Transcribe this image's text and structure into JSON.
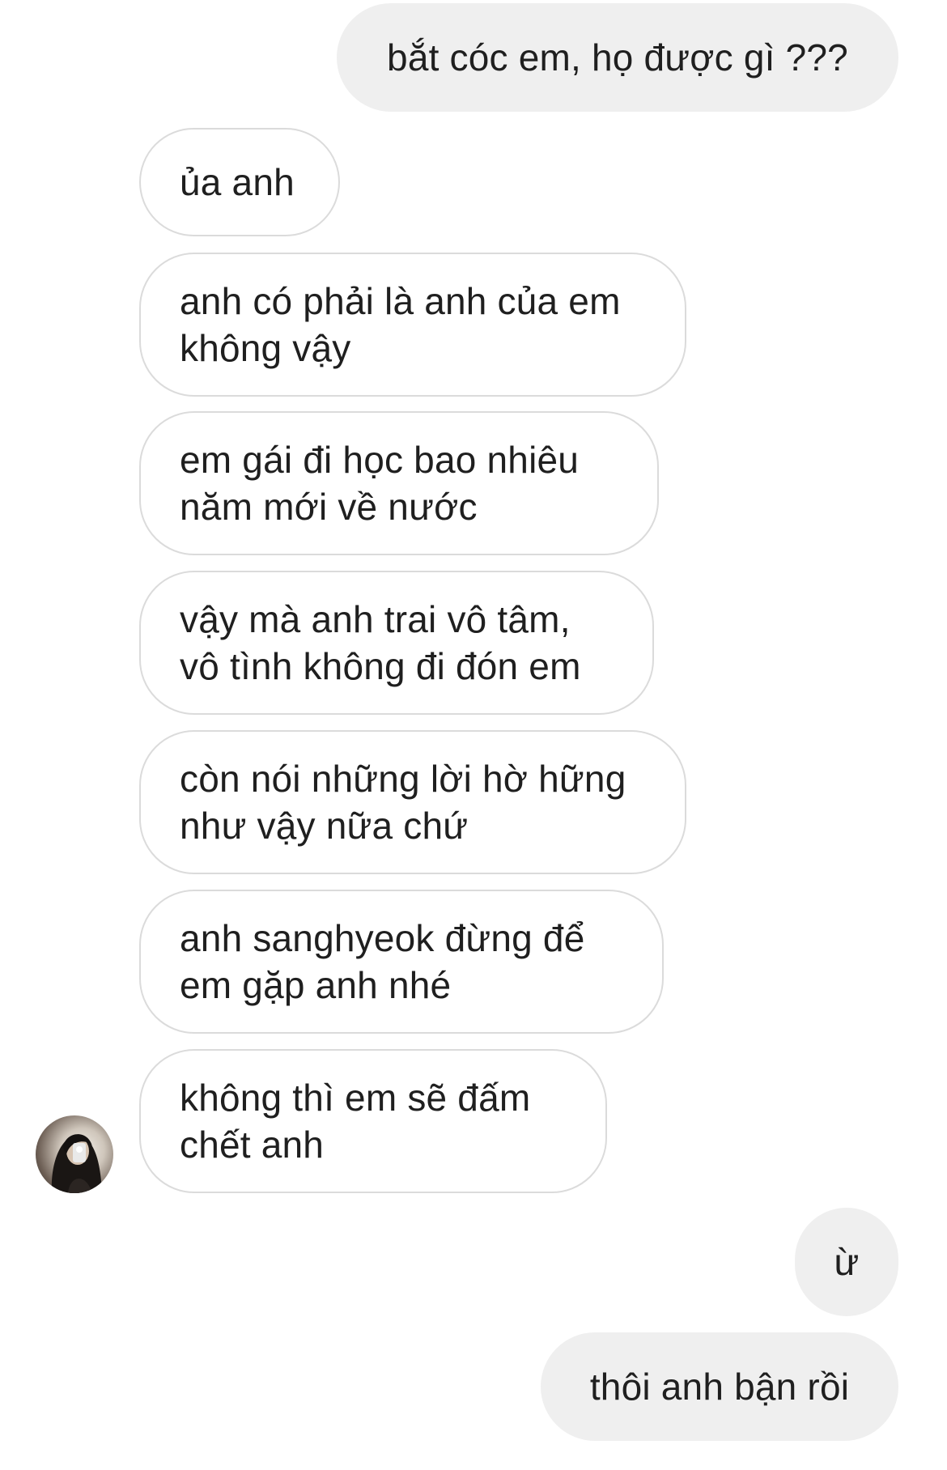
{
  "conversation": {
    "messages": [
      {
        "sender": "me",
        "text": "bắt cóc em, họ được gì ???"
      },
      {
        "sender": "them",
        "text": "ủa anh"
      },
      {
        "sender": "them",
        "text": "anh có phải là anh của em\nkhông vậy"
      },
      {
        "sender": "them",
        "text": "em gái đi học bao nhiêu\nnăm mới về nước"
      },
      {
        "sender": "them",
        "text": "vậy mà anh trai vô tâm,\nvô tình không đi đón em"
      },
      {
        "sender": "them",
        "text": "còn nói những lời hờ hững\nnhư vậy nữa chứ"
      },
      {
        "sender": "them",
        "text": "anh sanghyeok đừng để\nem gặp anh nhé"
      },
      {
        "sender": "them",
        "text": "không thì em sẽ đấm\nchết anh"
      },
      {
        "sender": "me",
        "text": "ừ"
      },
      {
        "sender": "me",
        "text": "thôi anh bận rồi"
      }
    ]
  },
  "avatar": {
    "icon": "contact-avatar"
  },
  "colors": {
    "sent_bubble": "#efefef",
    "received_border": "#dbdbdb",
    "text": "#1f1f1f",
    "background": "#ffffff"
  }
}
